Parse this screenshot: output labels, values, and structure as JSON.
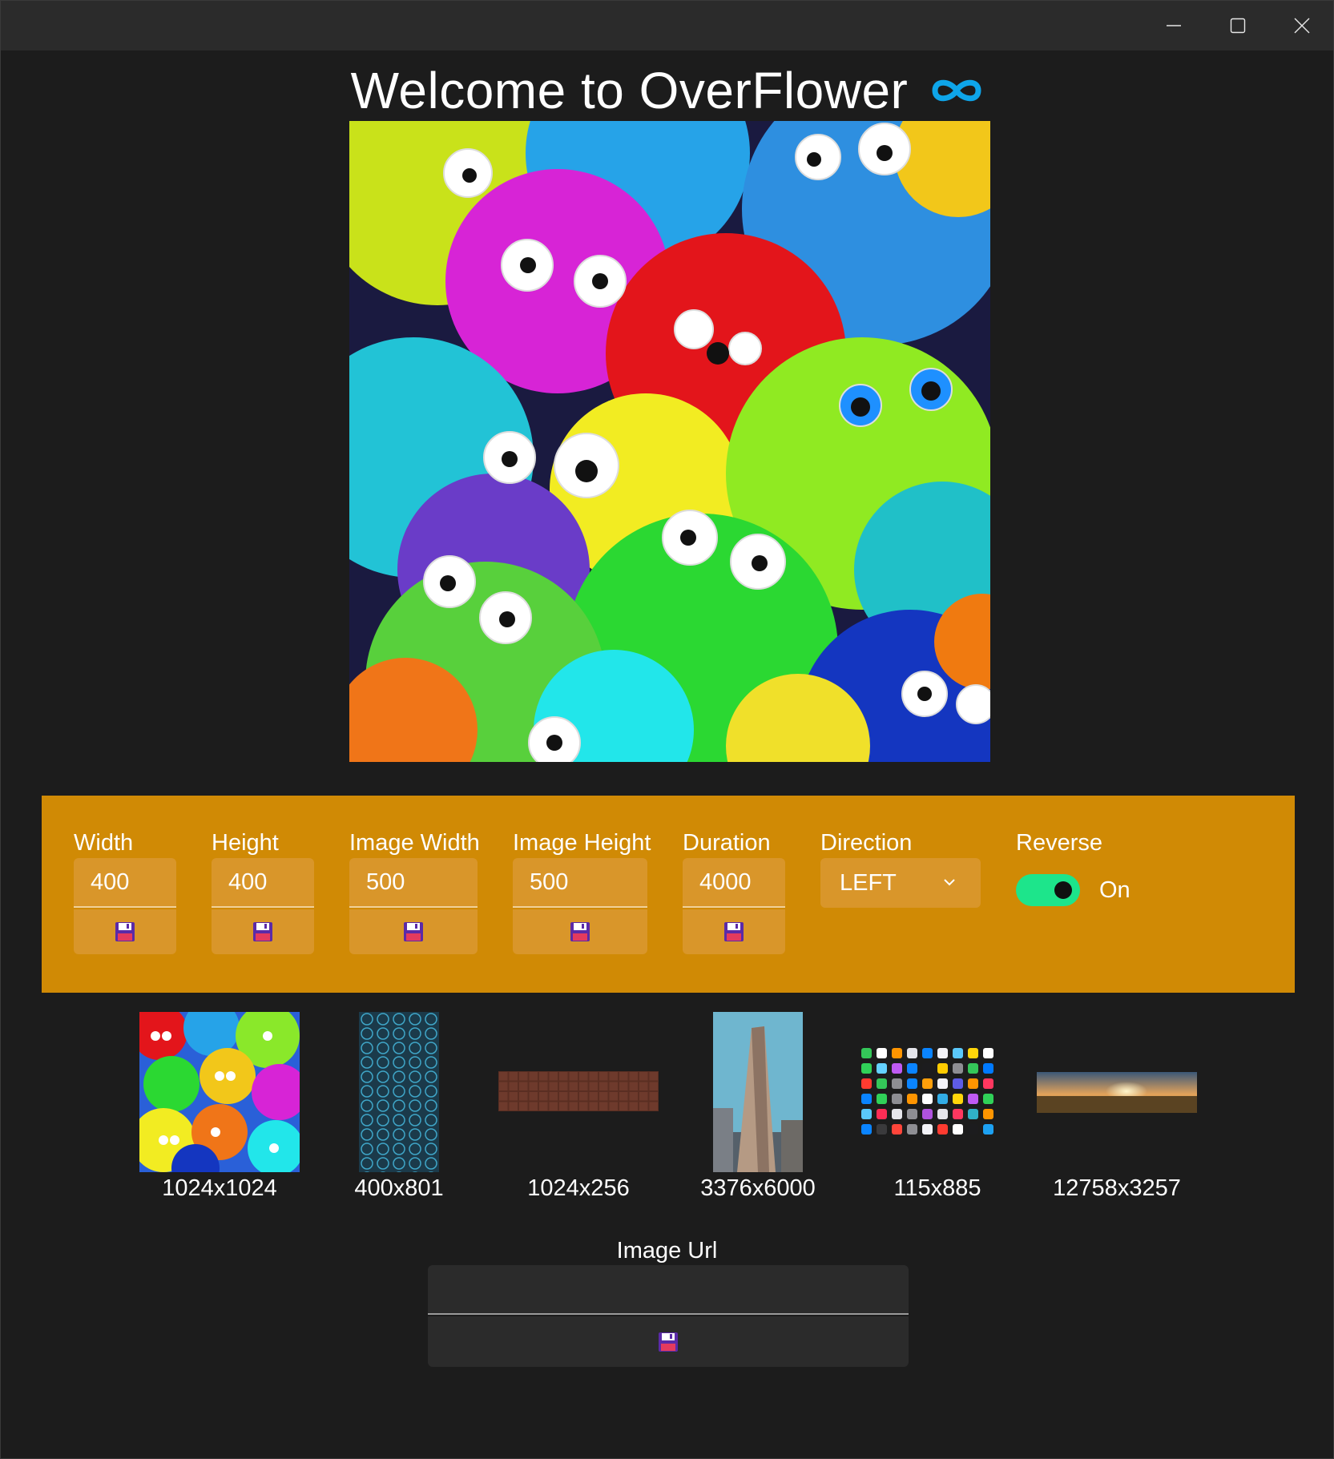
{
  "window": {
    "title": "Welcome to OverFlower",
    "logo_icon": "infinity-icon",
    "caption_buttons": [
      "minimize-icon",
      "maximize-icon",
      "close-icon"
    ],
    "accent_color": "#d08a05",
    "logo_color": "#0ea5e9",
    "toggle_color": "#1de58b"
  },
  "controls": {
    "width": {
      "label": "Width",
      "value": "400"
    },
    "height": {
      "label": "Height",
      "value": "400"
    },
    "image_width": {
      "label": "Image Width",
      "value": "500"
    },
    "image_height": {
      "label": "Image Height",
      "value": "500"
    },
    "duration": {
      "label": "Duration",
      "value": "4000"
    },
    "direction": {
      "label": "Direction",
      "value": "LEFT"
    },
    "reverse": {
      "label": "Reverse",
      "state": "On"
    },
    "save_icon": "floppy-disk-icon"
  },
  "thumbnails": [
    {
      "caption": "1024x1024"
    },
    {
      "caption": "400x801"
    },
    {
      "caption": "1024x256"
    },
    {
      "caption": "3376x6000"
    },
    {
      "caption": "115x885"
    },
    {
      "caption": "12758x3257"
    }
  ],
  "url_section": {
    "label": "Image Url",
    "value": ""
  }
}
